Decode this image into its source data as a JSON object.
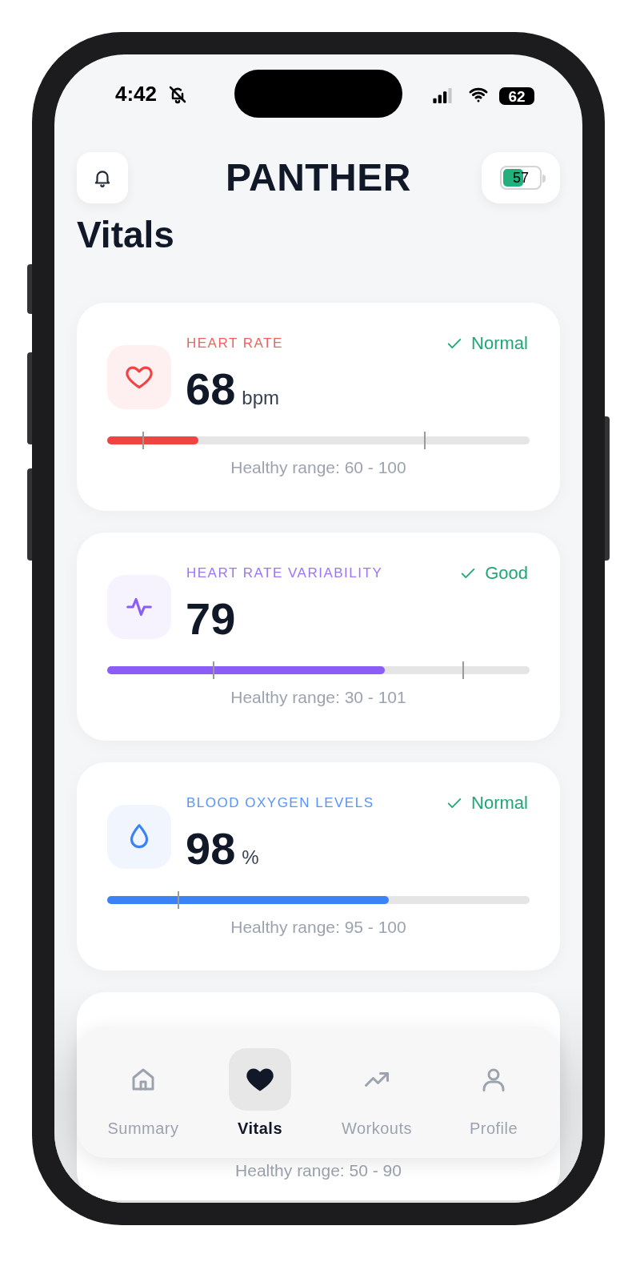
{
  "status_bar": {
    "time": "4:42",
    "silent": true,
    "battery": "62"
  },
  "header": {
    "title": "PANTHER",
    "device_battery": {
      "text": "57",
      "level": 0.57
    }
  },
  "page_title": "Vitals",
  "vitals": [
    {
      "kind": "heart",
      "label": "HEART RATE",
      "value": "68",
      "unit": "bpm",
      "status": "Normal",
      "level": 0.216,
      "markers": [
        {
          "level": 0.083
        },
        {
          "level": 0.75
        }
      ],
      "range": "Healthy range: 60 - 100",
      "color": "#ef4444"
    },
    {
      "kind": "pulse",
      "label": "HEART RATE VARIABILITY",
      "value": "79",
      "status": "Good",
      "level": 0.657,
      "markers": [
        {
          "level": 0.25
        },
        {
          "level": 0.841
        }
      ],
      "range": "Healthy range: 30 - 101",
      "color": "#8b5cf6"
    },
    {
      "kind": "drop",
      "label": "BLOOD OXYGEN LEVELS",
      "value": "98",
      "unit": "%",
      "status": "Normal",
      "level": 0.667,
      "markers": [
        {
          "level": 0.167
        }
      ],
      "range": "Healthy range: 95 - 100",
      "color": "#3b82f6"
    },
    {
      "kind": "hidden",
      "range": "Healthy range: 50 - 90"
    }
  ],
  "tab_bar": [
    {
      "kind": "home",
      "label": "Summary",
      "selected": false
    },
    {
      "kind": "heart",
      "label": "Vitals",
      "selected": true
    },
    {
      "kind": "trend",
      "label": "Workouts",
      "selected": false
    },
    {
      "kind": "person",
      "label": "Profile",
      "selected": false
    }
  ]
}
